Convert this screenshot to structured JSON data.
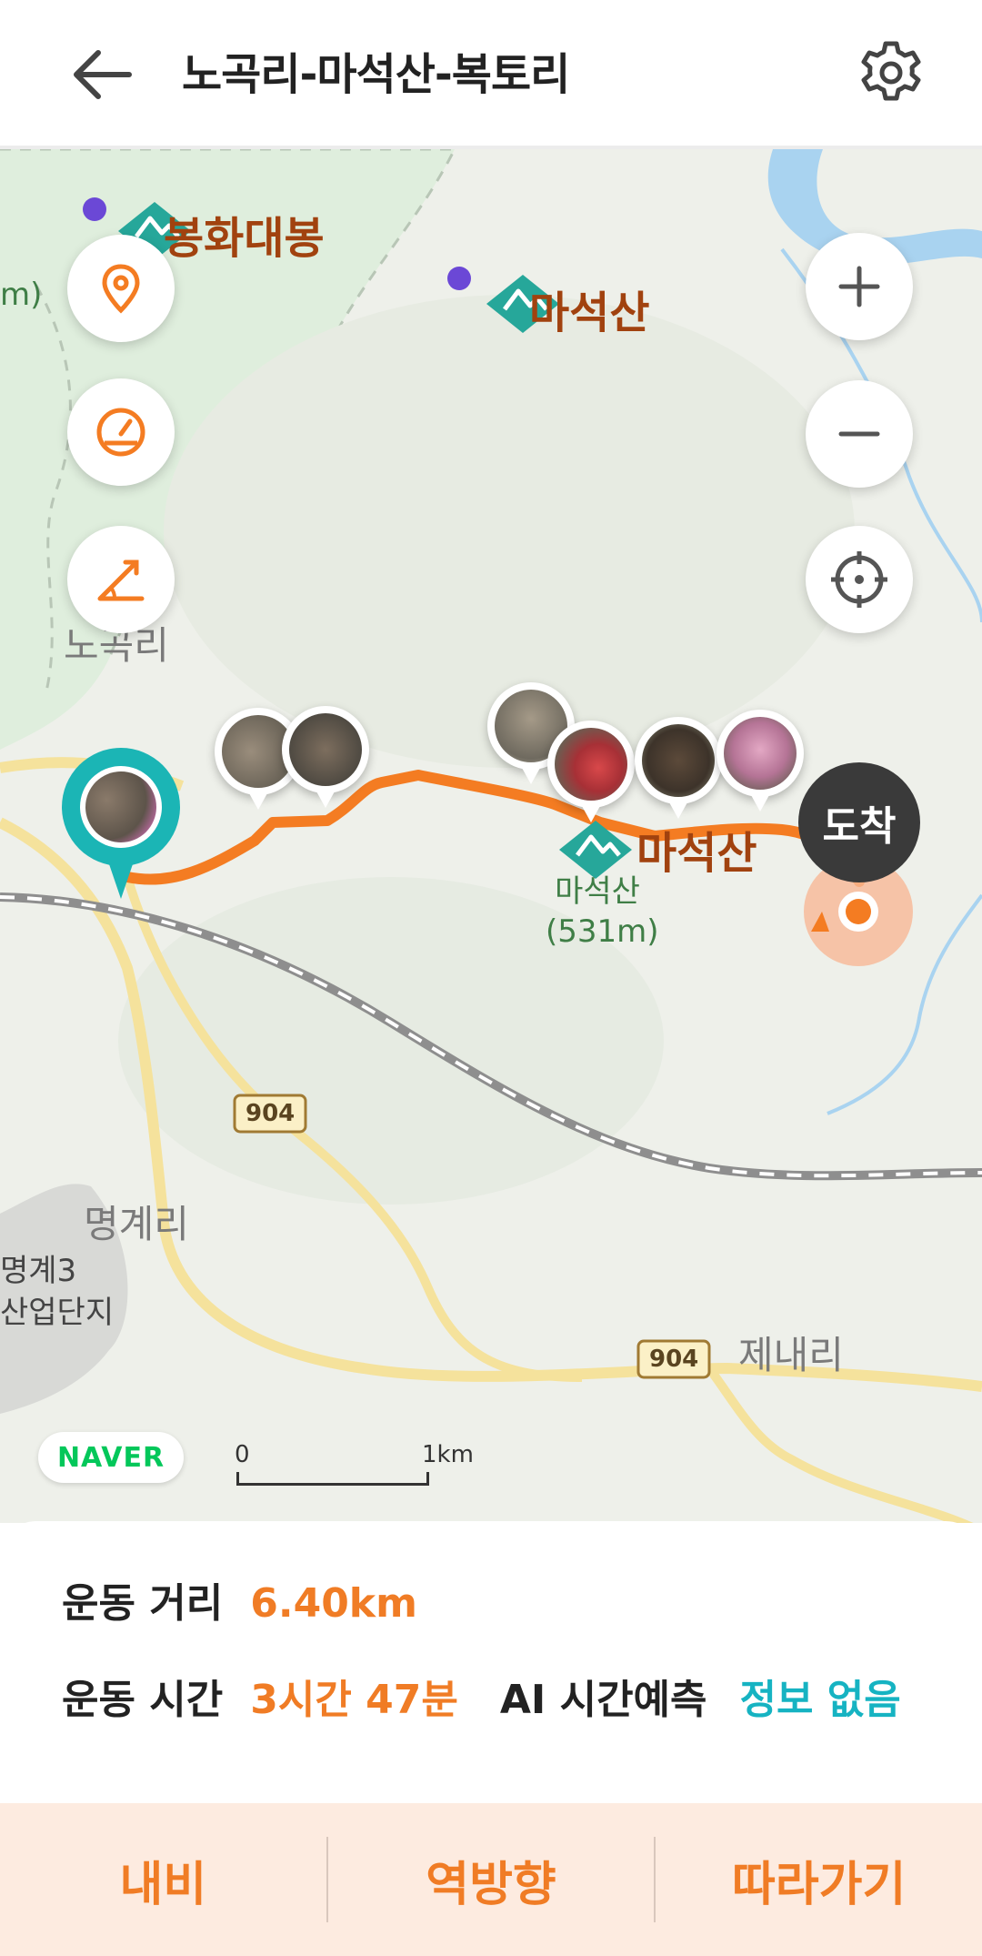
{
  "header": {
    "title": "노곡리-마석산-복토리"
  },
  "map": {
    "labels": {
      "peak_bonghwa": "봉화대봉",
      "peak_maseok_top": "마석산",
      "peak_maseok_route": "마석산",
      "village_nogok": "노곡리",
      "village_myeonggye": "명계리",
      "village_jenae": "제내리",
      "green_maseok": "마석산",
      "green_maseok_height": "(531m)",
      "industrial_line1": "명계3",
      "industrial_line2": "산업단지",
      "road_904_a": "904",
      "road_904_b": "904",
      "edge_m": "m)"
    },
    "arrival_label": "도착",
    "naver_logo": "NAVER",
    "scale": {
      "zero": "0",
      "end": "1km"
    },
    "colors": {
      "route": "#f47c22",
      "start": "#1bb5b5",
      "peak_marker": "#26a79a"
    }
  },
  "info": {
    "distance_label": "운동 거리",
    "distance_value": "6.40km",
    "time_label": "운동 시간",
    "time_value": "3시간 47분",
    "ai_label": "AI 시간예측",
    "ai_value": "정보 없음"
  },
  "bottom": {
    "navi": "내비",
    "reverse": "역방향",
    "follow": "따라가기"
  }
}
